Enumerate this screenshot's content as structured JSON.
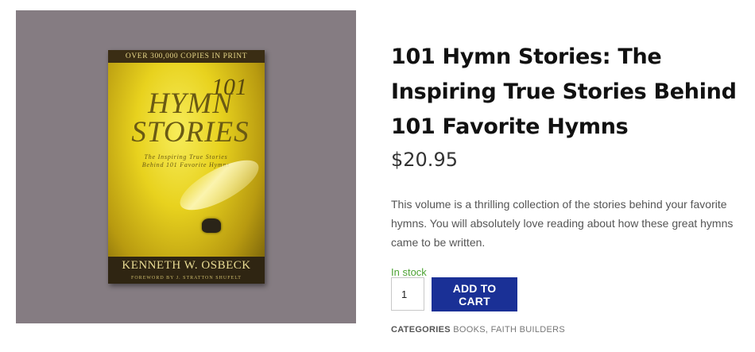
{
  "product": {
    "title": "101 Hymn Stories: The Inspiring True Stories Behind 101 Favorite Hymns",
    "price": "$20.95",
    "description": "This volume is a thrilling collection of the stories behind your favorite hymns. You will absolutely love reading about how these great hymns came to be written.",
    "stock_status": "In stock",
    "quantity": "1",
    "add_to_cart_label": "ADD TO CART",
    "categories_label": "CATEGORIES",
    "categories": [
      "BOOKS",
      "FAITH BUILDERS"
    ],
    "categories_separator": ", "
  },
  "book_cover": {
    "banner": "OVER 300,000 COPIES IN PRINT",
    "number": "101",
    "title": "HYMN STORIES",
    "subtitle": "The Inspiring True Stories Behind 101 Favorite Hymns",
    "author": "KENNETH W. OSBECK",
    "foreword": "FOREWORD BY J. STRATTON SHUFELT"
  },
  "colors": {
    "gallery_bg": "#857c82",
    "button_bg": "#1a3096",
    "stock_green": "#4ea335"
  }
}
